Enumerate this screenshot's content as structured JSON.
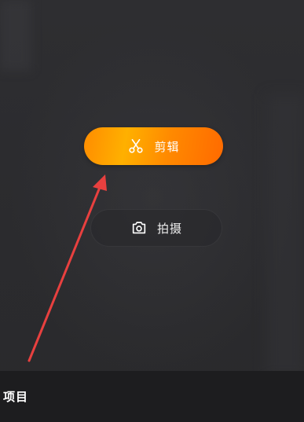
{
  "main": {
    "edit_button": {
      "label": "剪辑",
      "icon": "scissors-icon"
    },
    "shoot_button": {
      "label": "拍摄",
      "icon": "camera-icon"
    }
  },
  "annotation": {
    "arrow_color": "#e8403f"
  },
  "bottom_bar": {
    "projects_label": "项目"
  },
  "colors": {
    "background": "#2a2a2d",
    "accent_start": "#ff8c00",
    "accent_end": "#ff6a00",
    "bottom_bar": "#1d1d1f"
  }
}
